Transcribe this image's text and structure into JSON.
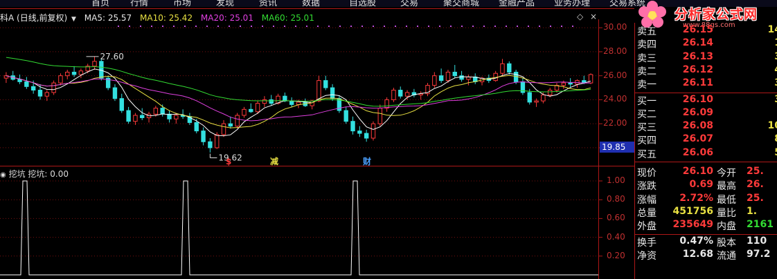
{
  "topbar": {
    "tabs": [
      "首页",
      "行情",
      "市场",
      "发现",
      "资讯",
      "数据",
      "自选股",
      "交易",
      "聚交商城",
      "金融产品",
      "业务办理",
      "交易系统"
    ],
    "tab_x": [
      132,
      188,
      250,
      312,
      374,
      436,
      504,
      578,
      640,
      720,
      800,
      880
    ]
  },
  "watermark": {
    "text": "分析家公式网",
    "url": "www.88gs.com"
  },
  "chart_header": {
    "name": "科A (日线,前复权)",
    "ma5": "MA5: 25.57",
    "ma10": "MA10: 25.42",
    "ma20": "MA20: 25.01",
    "ma60": "MA60: 25.01"
  },
  "colors": {
    "up": "#ff3a3a",
    "down": "#33e0e0",
    "ma5": "#ffffff",
    "ma10": "#e8e042",
    "ma20": "#e040e0",
    "ma60": "#33dd33",
    "grid": "#7a1010"
  },
  "price_axis": {
    "labels": [
      "30.00",
      "28.00",
      "26.00",
      "24.00",
      "22.00",
      "20.00"
    ],
    "current": "19.85"
  },
  "annotations": {
    "high": "27.60",
    "low": "19.62",
    "marks": [
      "$",
      "减",
      "财"
    ]
  },
  "indicator": {
    "name": "挖坑",
    "value": "挖坑: 0.00",
    "labels": [
      "1.00",
      "0.80",
      "0.60",
      "0.40",
      "0.20"
    ]
  },
  "chart_data": {
    "type": "candlestick",
    "ylim": [
      18.5,
      30.7
    ],
    "ohlc": [
      [
        25.8,
        26.3,
        25.4,
        26.0
      ],
      [
        26.0,
        26.4,
        25.6,
        25.7
      ],
      [
        25.7,
        26.1,
        25.3,
        25.5
      ],
      [
        25.5,
        25.9,
        24.9,
        25.1
      ],
      [
        25.1,
        25.6,
        24.5,
        24.8
      ],
      [
        24.8,
        25.3,
        24.0,
        24.3
      ],
      [
        24.3,
        24.8,
        23.9,
        24.6
      ],
      [
        24.6,
        25.6,
        24.4,
        25.4
      ],
      [
        25.4,
        26.2,
        25.2,
        26.0
      ],
      [
        26.0,
        26.5,
        25.7,
        26.3
      ],
      [
        26.3,
        26.8,
        25.9,
        26.1
      ],
      [
        26.1,
        26.6,
        25.8,
        26.4
      ],
      [
        26.4,
        27.0,
        26.2,
        26.8
      ],
      [
        26.8,
        27.6,
        26.5,
        27.2
      ],
      [
        27.2,
        27.4,
        25.6,
        25.8
      ],
      [
        25.8,
        26.0,
        24.8,
        25.0
      ],
      [
        25.0,
        25.3,
        23.9,
        24.1
      ],
      [
        24.1,
        24.5,
        22.9,
        23.1
      ],
      [
        23.1,
        23.4,
        22.0,
        22.2
      ],
      [
        22.2,
        22.9,
        21.9,
        22.7
      ],
      [
        22.7,
        23.3,
        22.3,
        22.5
      ],
      [
        22.5,
        23.0,
        22.1,
        22.8
      ],
      [
        22.8,
        23.5,
        22.6,
        23.3
      ],
      [
        23.3,
        23.6,
        22.6,
        22.8
      ],
      [
        22.8,
        23.1,
        22.1,
        22.4
      ],
      [
        22.4,
        22.9,
        22.0,
        22.7
      ],
      [
        22.7,
        23.2,
        22.4,
        22.6
      ],
      [
        22.6,
        22.9,
        21.9,
        22.1
      ],
      [
        22.1,
        22.4,
        21.2,
        21.4
      ],
      [
        21.4,
        21.7,
        20.2,
        20.5
      ],
      [
        20.5,
        20.8,
        19.6,
        20.0
      ],
      [
        20.0,
        21.3,
        19.9,
        21.1
      ],
      [
        21.1,
        22.3,
        20.9,
        22.0
      ],
      [
        22.0,
        22.6,
        21.6,
        21.8
      ],
      [
        21.8,
        22.9,
        21.6,
        22.7
      ],
      [
        22.7,
        23.4,
        22.5,
        23.2
      ],
      [
        23.2,
        23.7,
        22.9,
        23.0
      ],
      [
        23.0,
        23.9,
        22.8,
        23.7
      ],
      [
        23.7,
        24.3,
        23.4,
        24.0
      ],
      [
        24.0,
        24.4,
        23.5,
        23.7
      ],
      [
        23.7,
        24.5,
        23.6,
        24.3
      ],
      [
        24.3,
        24.6,
        23.8,
        23.9
      ],
      [
        23.9,
        24.2,
        23.4,
        23.6
      ],
      [
        23.6,
        24.0,
        23.3,
        23.8
      ],
      [
        23.8,
        24.1,
        23.4,
        23.5
      ],
      [
        23.5,
        24.0,
        23.2,
        23.9
      ],
      [
        23.9,
        26.0,
        23.8,
        25.6
      ],
      [
        25.6,
        26.0,
        24.8,
        25.0
      ],
      [
        25.0,
        25.3,
        23.9,
        24.1
      ],
      [
        24.1,
        24.3,
        22.9,
        23.1
      ],
      [
        23.1,
        23.4,
        22.0,
        22.2
      ],
      [
        22.2,
        22.6,
        21.1,
        21.4
      ],
      [
        21.4,
        21.8,
        20.9,
        21.2
      ],
      [
        21.2,
        21.5,
        20.5,
        20.8
      ],
      [
        20.8,
        22.2,
        20.6,
        22.0
      ],
      [
        22.0,
        23.6,
        21.8,
        23.3
      ],
      [
        23.3,
        24.2,
        23.0,
        24.0
      ],
      [
        24.0,
        25.0,
        23.8,
        24.8
      ],
      [
        24.8,
        25.1,
        24.1,
        24.3
      ],
      [
        24.3,
        24.8,
        24.0,
        24.6
      ],
      [
        24.6,
        24.9,
        24.2,
        24.4
      ],
      [
        24.4,
        24.7,
        24.0,
        24.5
      ],
      [
        24.5,
        25.4,
        24.3,
        25.2
      ],
      [
        25.2,
        26.3,
        25.0,
        26.0
      ],
      [
        26.0,
        26.6,
        25.4,
        25.6
      ],
      [
        25.6,
        26.5,
        25.4,
        26.3
      ],
      [
        26.3,
        26.9,
        25.8,
        26.0
      ],
      [
        26.0,
        26.4,
        25.5,
        25.7
      ],
      [
        25.7,
        26.1,
        25.2,
        25.9
      ],
      [
        25.9,
        26.2,
        25.3,
        25.5
      ],
      [
        25.5,
        25.9,
        25.2,
        25.8
      ],
      [
        25.8,
        26.1,
        25.4,
        25.6
      ],
      [
        25.6,
        26.4,
        25.5,
        26.2
      ],
      [
        26.2,
        27.4,
        26.0,
        27.0
      ],
      [
        27.0,
        27.2,
        26.1,
        26.3
      ],
      [
        26.3,
        26.5,
        25.3,
        25.5
      ],
      [
        25.5,
        25.8,
        24.4,
        24.6
      ],
      [
        24.6,
        24.9,
        23.6,
        23.8
      ],
      [
        23.8,
        24.1,
        23.4,
        23.9
      ],
      [
        23.9,
        24.6,
        23.7,
        24.4
      ],
      [
        24.4,
        25.0,
        24.2,
        24.8
      ],
      [
        24.8,
        25.4,
        24.6,
        25.2
      ],
      [
        25.2,
        25.6,
        24.9,
        25.4
      ],
      [
        25.4,
        25.8,
        25.0,
        25.3
      ],
      [
        25.3,
        25.7,
        25.0,
        25.6
      ],
      [
        25.6,
        26.0,
        25.3,
        25.4
      ],
      [
        25.4,
        26.2,
        25.3,
        26.1
      ]
    ],
    "signals": [
      6,
      46,
      87
    ]
  },
  "quote": {
    "asks": [
      {
        "label": "卖五",
        "price": "26.15",
        "vol": "14"
      },
      {
        "label": "卖四",
        "price": "26.14",
        "vol": "1"
      },
      {
        "label": "卖三",
        "price": "26.13",
        "vol": "3"
      },
      {
        "label": "卖二",
        "price": "26.12",
        "vol": "4"
      },
      {
        "label": "卖一",
        "price": "26.11",
        "vol": "3"
      }
    ],
    "bids": [
      {
        "label": "买一",
        "price": "26.10",
        "vol": "3"
      },
      {
        "label": "买二",
        "price": "26.09",
        "vol": ""
      },
      {
        "label": "买三",
        "price": "26.08",
        "vol": "10"
      },
      {
        "label": "买四",
        "price": "26.07",
        "vol": "8"
      },
      {
        "label": "买五",
        "price": "26.06",
        "vol": "5"
      }
    ],
    "stats": [
      {
        "l1": "现价",
        "v1": "26.10",
        "c1": "red",
        "l2": "今开",
        "v2": "25.",
        "c2": "red"
      },
      {
        "l1": "涨跌",
        "v1": "0.69",
        "c1": "red",
        "l2": "最高",
        "v2": "26.",
        "c2": "red"
      },
      {
        "l1": "涨幅",
        "v1": "2.72%",
        "c1": "red",
        "l2": "最低",
        "v2": "25.",
        "c2": "red"
      },
      {
        "l1": "总量",
        "v1": "451756",
        "c1": "yellow",
        "l2": "量比",
        "v2": "1.",
        "c2": "yellow"
      },
      {
        "l1": "外盘",
        "v1": "235649",
        "c1": "red",
        "l2": "内盘",
        "v2": "2161",
        "c2": "green"
      },
      {
        "l1": "换手",
        "v1": "0.47%",
        "c1": "white",
        "l2": "股本",
        "v2": "110",
        "c2": "white"
      },
      {
        "l1": "净资",
        "v1": "12.68",
        "c1": "white",
        "l2": "流通",
        "v2": "97.2",
        "c2": "white"
      }
    ]
  }
}
